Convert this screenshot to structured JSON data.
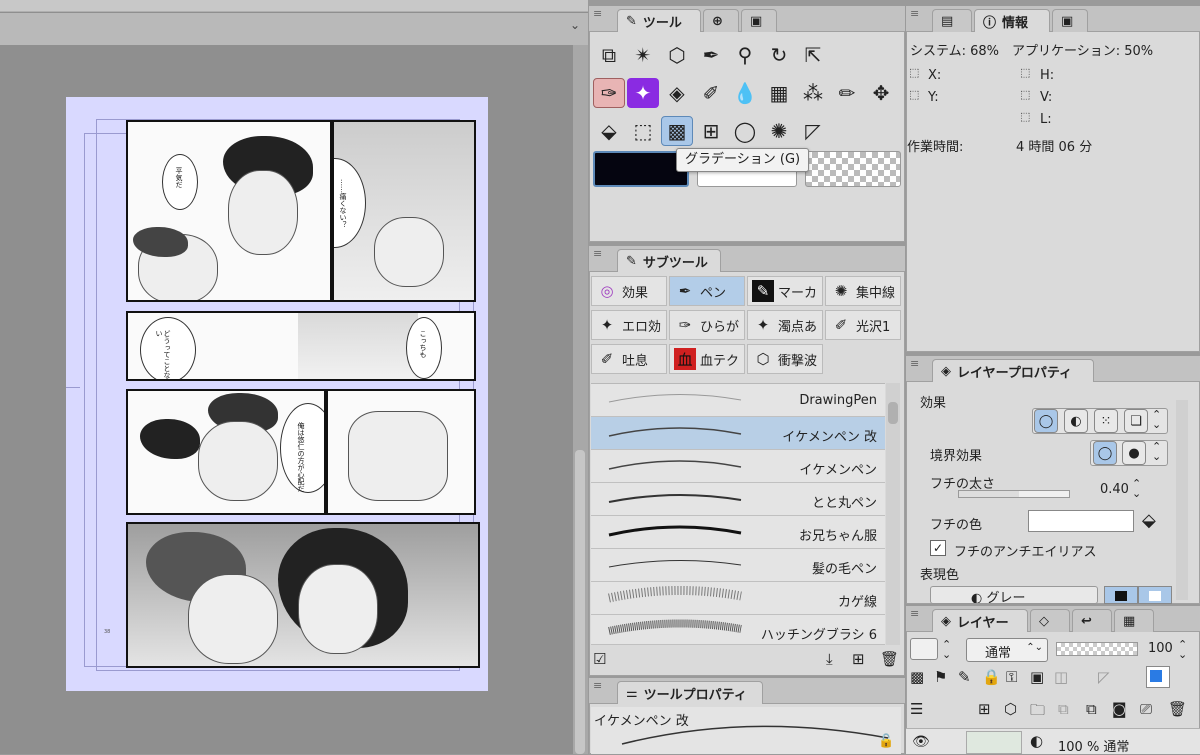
{
  "tool_panel": {
    "tab_label": "ツール",
    "tooltip": "グラデーション (G)",
    "tools_row1": [
      "layer-select-icon",
      "magic-wand-icon",
      "object-select-icon",
      "eyedropper-icon",
      "zoom-icon",
      "rotate-icon",
      "move-arrow-icon"
    ],
    "tools_row2": [
      "pen-nib-icon",
      "sparkle-icon",
      "eraser-icon",
      "brush-icon",
      "blend-icon",
      "grid-fill-icon",
      "spray-icon",
      "pencil-icon",
      "move-cross-icon"
    ],
    "tools_row3": [
      "fill-bucket-icon",
      "selection-rect-icon",
      "gradient-icon",
      "frame-icon",
      "balloon-icon",
      "speedline-icon",
      "ruler-icon"
    ],
    "color_main": "#050510",
    "color_sub": "#ffffff"
  },
  "info_panel": {
    "tab_label": "情報",
    "system_label": "システム: 68%",
    "app_label": "アプリケーション: 50%",
    "x_label": "X:",
    "y_label": "Y:",
    "h_label": "H:",
    "v_label": "V:",
    "l_label": "L:",
    "work_time_label": "作業時間:",
    "work_time_value": "4 時間 06 分"
  },
  "subtool_panel": {
    "tab_label": "サブツール",
    "groups": [
      {
        "label": "効果",
        "icon": "spiral-icon"
      },
      {
        "label": "ペン",
        "icon": "pen-icon"
      },
      {
        "label": "マーカ",
        "icon": "marker-icon"
      },
      {
        "label": "集中線",
        "icon": "focus-lines-icon"
      },
      {
        "label": "エロ効",
        "icon": "sparkle-icon"
      },
      {
        "label": "ひらが",
        "icon": "pen-nib-icon"
      },
      {
        "label": "濁点あ",
        "icon": "sparkle-icon"
      },
      {
        "label": "光沢1",
        "icon": "gloss-icon"
      },
      {
        "label": "吐息",
        "icon": "breath-icon"
      },
      {
        "label": "血テク",
        "icon": "blood-icon"
      },
      {
        "label": "衝撃波",
        "icon": "shockwave-icon"
      }
    ],
    "brushes": [
      {
        "name": "DrawingPen"
      },
      {
        "name": "イケメンペン 改"
      },
      {
        "name": "イケメンペン"
      },
      {
        "name": "とと丸ペン"
      },
      {
        "name": "お兄ちゃん服"
      },
      {
        "name": "髪の毛ペン"
      },
      {
        "name": "カゲ線"
      },
      {
        "name": "ハッチングブラシ 6"
      }
    ]
  },
  "tool_property": {
    "tab_label": "ツールプロパティ",
    "brush_name": "イケメンペン 改"
  },
  "layer_property": {
    "tab_label": "レイヤープロパティ",
    "effect_label": "効果",
    "border_effect_label": "境界効果",
    "edge_width_label": "フチの太さ",
    "edge_width_value": "0.40",
    "edge_color_label": "フチの色",
    "edge_antialias_label": "フチのアンチエイリアス",
    "expression_color_label": "表現色",
    "expression_color_value": "グレー"
  },
  "layer_panel": {
    "tab_label": "レイヤー",
    "blend_mode": "通常",
    "opacity": "100",
    "layer_opacity_mode": "100 % 通常"
  },
  "manga": {
    "bubble1": "平気だ",
    "bubble2": "……痛くない？",
    "bubble3": "どうってことない",
    "bubble4": "こっちも",
    "bubble5": "俺は悠仁の方が心配だ",
    "page_num": "38"
  }
}
